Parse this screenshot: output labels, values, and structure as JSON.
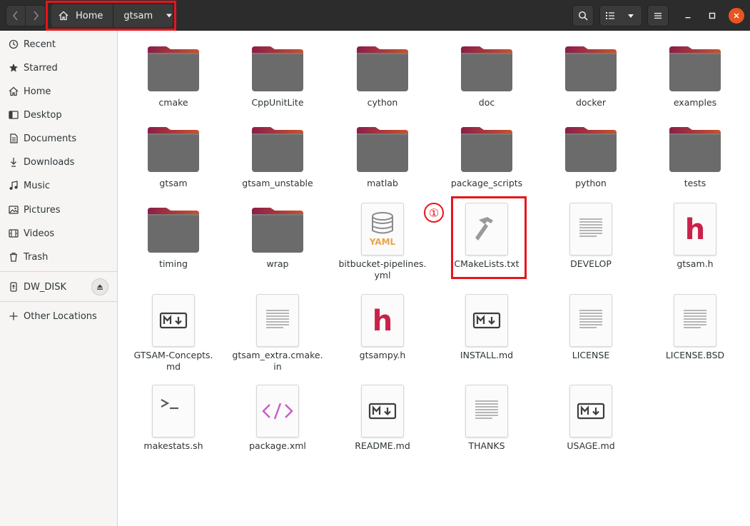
{
  "header": {
    "breadcrumb": [
      {
        "label": "Home",
        "icon": "home-icon"
      },
      {
        "label": "gtsam",
        "icon": "chevron-down-icon"
      }
    ],
    "colors": {
      "headerbar": "#2c2c2c",
      "close_button": "#e95420",
      "annotation": "#e8141b"
    }
  },
  "sidebar": {
    "items": [
      {
        "label": "Recent",
        "icon": "clock-icon"
      },
      {
        "label": "Starred",
        "icon": "star-icon"
      },
      {
        "label": "Home",
        "icon": "home-icon"
      },
      {
        "label": "Desktop",
        "icon": "desktop-icon"
      },
      {
        "label": "Documents",
        "icon": "document-icon"
      },
      {
        "label": "Downloads",
        "icon": "download-icon"
      },
      {
        "label": "Music",
        "icon": "music-icon"
      },
      {
        "label": "Pictures",
        "icon": "picture-icon"
      },
      {
        "label": "Videos",
        "icon": "video-icon"
      },
      {
        "label": "Trash",
        "icon": "trash-icon"
      }
    ],
    "drives": [
      {
        "label": "DW_DISK",
        "icon": "usb-drive-icon"
      }
    ],
    "other": {
      "label": "Other Locations",
      "icon": "plus-icon"
    }
  },
  "files": [
    {
      "name": "cmake",
      "type": "folder"
    },
    {
      "name": "CppUnitLite",
      "type": "folder"
    },
    {
      "name": "cython",
      "type": "folder"
    },
    {
      "name": "doc",
      "type": "folder"
    },
    {
      "name": "docker",
      "type": "folder"
    },
    {
      "name": "examples",
      "type": "folder"
    },
    {
      "name": "gtsam",
      "type": "folder"
    },
    {
      "name": "gtsam_unstable",
      "type": "folder"
    },
    {
      "name": "matlab",
      "type": "folder"
    },
    {
      "name": "package_scripts",
      "type": "folder"
    },
    {
      "name": "python",
      "type": "folder"
    },
    {
      "name": "tests",
      "type": "folder"
    },
    {
      "name": "timing",
      "type": "folder"
    },
    {
      "name": "wrap",
      "type": "folder"
    },
    {
      "name": "bitbucket-pipelines.\nyml",
      "type": "yaml"
    },
    {
      "name": "CMakeLists.txt",
      "type": "cmake"
    },
    {
      "name": "DEVELOP",
      "type": "text"
    },
    {
      "name": "gtsam.h",
      "type": "header"
    },
    {
      "name": "GTSAM-Concepts.\nmd",
      "type": "markdown"
    },
    {
      "name": "gtsam_extra.cmake.\nin",
      "type": "text"
    },
    {
      "name": "gtsampy.h",
      "type": "header"
    },
    {
      "name": "INSTALL.md",
      "type": "markdown"
    },
    {
      "name": "LICENSE",
      "type": "text"
    },
    {
      "name": "LICENSE.BSD",
      "type": "text"
    },
    {
      "name": "makestats.sh",
      "type": "shell"
    },
    {
      "name": "package.xml",
      "type": "xml"
    },
    {
      "name": "README.md",
      "type": "markdown"
    },
    {
      "name": "THANKS",
      "type": "text"
    },
    {
      "name": "USAGE.md",
      "type": "markdown"
    }
  ],
  "annotation": {
    "number": "①"
  }
}
